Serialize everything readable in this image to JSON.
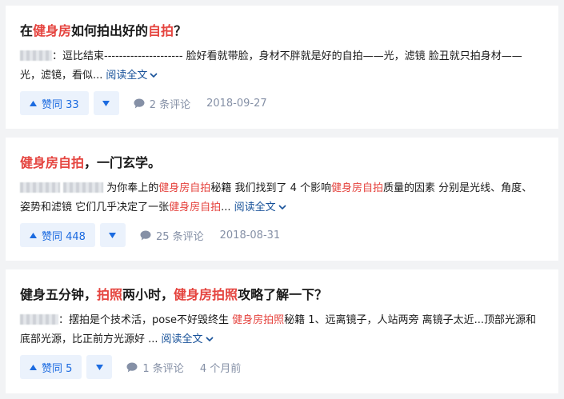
{
  "items": [
    {
      "title_parts": [
        "在",
        "健身房",
        "如何拍出好的",
        "自拍",
        "？"
      ],
      "excerpt": {
        "text": "：逗比结束--------------------- 脸好看就带脸，身材不胖就是好的自拍——光，滤镜 脸丑就只拍身材——光，滤镜，看似..."
      },
      "read_more": "阅读全文",
      "upvote_label": "赞同 33",
      "comment_label": "2 条评论",
      "date": "2018-09-27"
    },
    {
      "title_parts": [
        "健身房自拍",
        "，一门玄学。"
      ],
      "excerpt": {
        "parts": [
          "为你奉上的",
          "健身房自拍",
          "秘籍 我们找到了 4 个影响",
          "健身房自拍",
          "质量的因素 分别是光线、角度、姿势和滤镜 它们几乎决定了一张",
          "健身房自拍",
          "..."
        ]
      },
      "read_more": "阅读全文",
      "upvote_label": "赞同 448",
      "comment_label": "25 条评论",
      "date": "2018-08-31"
    },
    {
      "title_parts": [
        "健身五分钟，",
        "拍照",
        "两小时，",
        "健身房拍照",
        "攻略了解一下？"
      ],
      "excerpt": {
        "parts": [
          "：摆拍是个技术活，pose不好毁终生 ",
          "健身房拍照",
          "秘籍 1、远离镜子，人站两旁 离镜子太近...顶部光源和底部光源，比正前方光源好 ..."
        ]
      },
      "read_more": "阅读全文",
      "upvote_label": "赞同 5",
      "comment_label": "1 条评论",
      "date": "4 个月前"
    }
  ],
  "colors": {
    "highlight": "#e5443f",
    "vote_bg": "#ebf2fc",
    "vote_text": "#1c6be0",
    "meta_text": "#8590a6",
    "link": "#175199"
  },
  "icons": {
    "upvote": "triangle-up-icon",
    "downvote": "triangle-down-icon",
    "comment": "comment-bubble-icon",
    "read_more": "chevron-down-icon"
  }
}
